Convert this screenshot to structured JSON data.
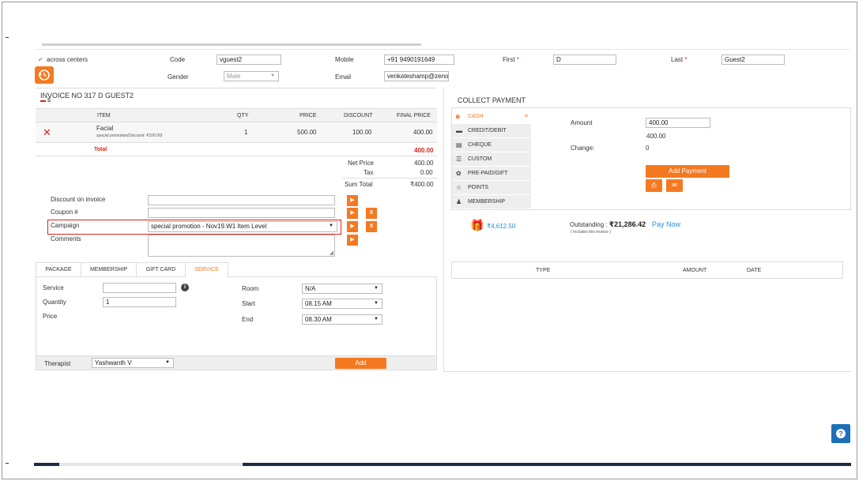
{
  "customer": {
    "across_centers": "across centers",
    "code_label": "Code",
    "code_value": "vguest2",
    "mobile_label": "Mobile",
    "mobile_value": "+91 9490191649",
    "first_label": "First",
    "first_value": "D",
    "last_label": "Last",
    "last_value": "Guest2",
    "gender_label": "Gender",
    "gender_value": "Male",
    "email_label": "Email",
    "email_value": "venkateshamp@zeno",
    "required_mark": "*"
  },
  "invoice": {
    "title": "INVOICE NO 317  D GUEST2",
    "currency": "$",
    "headers": {
      "item": "ITEM",
      "qty": "QTY",
      "price": "PRICE",
      "discount": "DISCOUNT",
      "final_price": "FINAL PRICE"
    },
    "row": {
      "item": "Facial",
      "subtext": "special promotion(Discount: ₹100.00)",
      "qty": "1",
      "price": "500.00",
      "discount": "100.00",
      "final_price": "400.00"
    },
    "total_label": "Total",
    "total_value": "400.00",
    "net_price_label": "Net Price",
    "net_price_value": "400.00",
    "tax_label": "Tax",
    "tax_value": "0.00",
    "sum_total_label": "Sum Total",
    "sum_total_value": "₹400.00",
    "discount_label": "Discount on invoice",
    "coupon_label": "Coupon #",
    "campaign_label": "Campaign",
    "campaign_value": "special promotion - Nov19.W1 Item Level",
    "comments_label": "Comments"
  },
  "tabs": {
    "package": "PACKAGE",
    "membership": "MEMBERSHIP",
    "gift_card": "GIFT CARD",
    "service": "SERVICE"
  },
  "service_form": {
    "service_label": "Service",
    "quantity_label": "Quantity",
    "quantity_value": "1",
    "price_label": "Price",
    "room_label": "Room",
    "room_value": "N/A",
    "start_label": "Start",
    "start_value": "08.15 AM",
    "end_label": "End",
    "end_value": "08.30 AM",
    "therapist_label": "Therapist",
    "therapist_value": "Yashwanth V",
    "add_label": "Add"
  },
  "payment": {
    "title": "COLLECT PAYMENT",
    "methods": [
      "CASH",
      "CREDIT/DEBIT",
      "CHEQUE",
      "CUSTOM",
      "PRE-PAID/GIFT",
      "POINTS",
      "MEMBERSHIP"
    ],
    "amount_label": "Amount",
    "amount_value": "400.00",
    "amount_echo": "400.00",
    "change_label": "Change:",
    "change_value": "0",
    "add_payment_label": "Add Payment",
    "wallet_value": "₹4,612.50",
    "outstanding_label": "Outstanding :",
    "outstanding_value": "₹21,286.42",
    "outstanding_note": "( Includes this invoice )",
    "pay_now_label": "Pay Now",
    "table_headers": {
      "type": "TYPE",
      "amount": "AMOUNT",
      "date": "DATE"
    }
  },
  "help_icon": "?",
  "colors": {
    "accent": "#f47920",
    "danger": "#d9261c",
    "link": "#2a8dd4",
    "help": "#1e6fb8"
  }
}
